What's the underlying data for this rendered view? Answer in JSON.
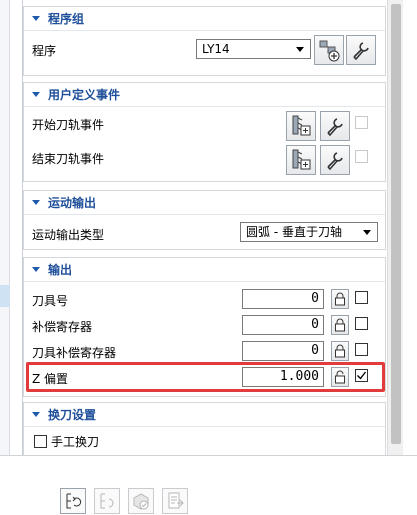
{
  "groups": {
    "program_group": {
      "title": "程序组",
      "program_label": "程序",
      "program_value": "LY14"
    },
    "user_events": {
      "title": "用户定义事件",
      "start_label": "开始刀轨事件",
      "end_label": "结束刀轨事件"
    },
    "motion_output": {
      "title": "运动输出",
      "type_label": "运动输出类型",
      "type_value": "圆弧 - 垂直于刀轴"
    },
    "output": {
      "title": "输出",
      "rows": [
        {
          "label": "刀具号",
          "value": "0",
          "checked": false
        },
        {
          "label": "补偿寄存器",
          "value": "0",
          "checked": false
        },
        {
          "label": "刀具补偿寄存器",
          "value": "0",
          "checked": false
        },
        {
          "label": "Z 偏置",
          "value": "1.000",
          "checked": true
        }
      ]
    },
    "tool_change": {
      "title": "换刀设置",
      "manual_label": "手工换刀"
    }
  },
  "icons": {
    "create_program": "create-program-icon",
    "edit": "wrench-icon",
    "event": "tool-event-icon",
    "lock": "lock-icon"
  },
  "colors": {
    "header_text": "#1e4f9a",
    "highlight": "#e23b3b"
  }
}
